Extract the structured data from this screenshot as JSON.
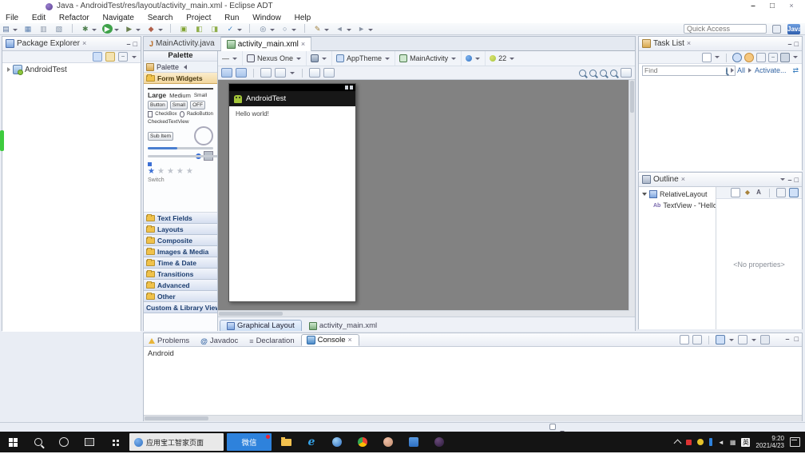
{
  "window": {
    "title": "Java - AndroidTest/res/layout/activity_main.xml - Eclipse ADT"
  },
  "menu": {
    "items": [
      "File",
      "Edit",
      "Refactor",
      "Navigate",
      "Search",
      "Project",
      "Run",
      "Window",
      "Help"
    ]
  },
  "main_toolbar": {
    "icons": [
      {
        "name": "new-wizard",
        "glyph": "▤"
      },
      {
        "name": "save",
        "glyph": "▦"
      },
      {
        "name": "print",
        "glyph": "▥"
      },
      {
        "name": "export",
        "glyph": "▧"
      },
      {
        "name": "debug",
        "glyph": "✱"
      },
      {
        "name": "run",
        "glyph": "▶"
      },
      {
        "name": "external-tools",
        "glyph": "▶"
      },
      {
        "name": "coverage",
        "glyph": "◆"
      },
      {
        "name": "new-android-app",
        "glyph": "▣"
      },
      {
        "name": "sdk-manager",
        "glyph": "◧"
      },
      {
        "name": "avd-manager",
        "glyph": "◨"
      },
      {
        "name": "lint",
        "glyph": "✓"
      },
      {
        "name": "new-type",
        "glyph": "◎"
      },
      {
        "name": "search",
        "glyph": "○"
      },
      {
        "name": "annotate",
        "glyph": "✎"
      },
      {
        "name": "back",
        "glyph": "◄"
      },
      {
        "name": "forward",
        "glyph": "►"
      }
    ]
  },
  "quick_access": {
    "placeholder": "Quick Access",
    "perspective": "Java"
  },
  "package_explorer": {
    "title": "Package Explorer",
    "project": "AndroidTest"
  },
  "editor": {
    "tabs": {
      "java": "MainActivity.java",
      "xml": "activity_main.xml"
    },
    "config": {
      "configuration": "—",
      "device": "Nexus One",
      "theme": "AppTheme",
      "activity": "MainActivity",
      "api_level": "22"
    },
    "palette": {
      "view_title": "Palette",
      "header": "Palette",
      "active_category": "Form Widgets",
      "preview": {
        "large_text": "Large",
        "medium_text": "Medium",
        "small_text": "Small",
        "button": "Button",
        "small_button": "Small",
        "toggle": "OFF",
        "checkbox": "CheckBox",
        "radio": "RadioButton",
        "checked_textview": "CheckedTextView",
        "spinner": "Sub Item",
        "switch": "Switch"
      },
      "categories": [
        "Text Fields",
        "Layouts",
        "Composite",
        "Images & Media",
        "Time & Date",
        "Transitions",
        "Advanced",
        "Other",
        "Custom & Library Views"
      ]
    },
    "canvas": {
      "app_title": "AndroidTest",
      "content_text": "Hello world!"
    },
    "bottom_tabs": {
      "graphical": "Graphical Layout",
      "xml": "activity_main.xml"
    }
  },
  "task_list": {
    "title": "Task List",
    "find_placeholder": "Find",
    "all_link": "All",
    "activate_link": "Activate..."
  },
  "outline": {
    "title": "Outline",
    "root": "RelativeLayout",
    "child_icon": "Ab",
    "child": "TextView - \"Hello...\"",
    "no_properties": "<No properties>"
  },
  "bottom_panel": {
    "tabs": {
      "problems": "Problems",
      "javadoc": "Javadoc",
      "declaration": "Declaration",
      "console": "Console"
    },
    "console_name": "Android"
  },
  "taskbar": {
    "active_app": "应用宝工智家页面",
    "wechat": "微信",
    "ime": "英",
    "time": "9:20",
    "date": "2021/4/23"
  },
  "colors": {
    "accent_blue": "#3465a4",
    "android_green": "#a4c639",
    "run_green": "#3fa24a",
    "wechat_blue": "#2e82dc",
    "canvas_gray": "#828282",
    "taskbar_bg": "#141414"
  }
}
